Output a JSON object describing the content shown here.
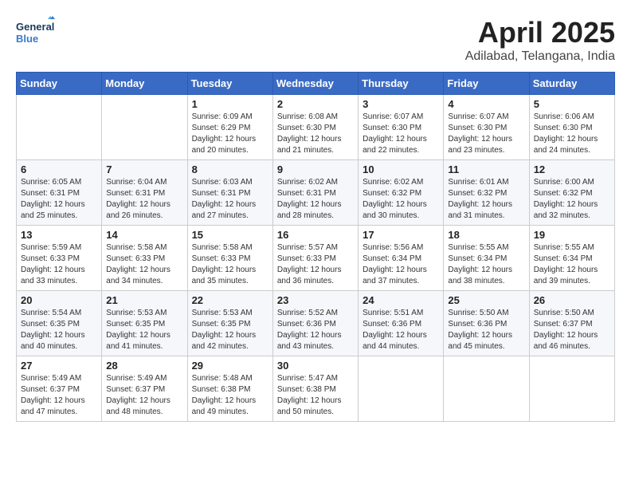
{
  "header": {
    "logo_line1": "General",
    "logo_line2": "Blue",
    "month_year": "April 2025",
    "location": "Adilabad, Telangana, India"
  },
  "weekdays": [
    "Sunday",
    "Monday",
    "Tuesday",
    "Wednesday",
    "Thursday",
    "Friday",
    "Saturday"
  ],
  "weeks": [
    [
      {
        "day": "",
        "sunrise": "",
        "sunset": "",
        "daylight": ""
      },
      {
        "day": "",
        "sunrise": "",
        "sunset": "",
        "daylight": ""
      },
      {
        "day": "1",
        "sunrise": "Sunrise: 6:09 AM",
        "sunset": "Sunset: 6:29 PM",
        "daylight": "Daylight: 12 hours and 20 minutes."
      },
      {
        "day": "2",
        "sunrise": "Sunrise: 6:08 AM",
        "sunset": "Sunset: 6:30 PM",
        "daylight": "Daylight: 12 hours and 21 minutes."
      },
      {
        "day": "3",
        "sunrise": "Sunrise: 6:07 AM",
        "sunset": "Sunset: 6:30 PM",
        "daylight": "Daylight: 12 hours and 22 minutes."
      },
      {
        "day": "4",
        "sunrise": "Sunrise: 6:07 AM",
        "sunset": "Sunset: 6:30 PM",
        "daylight": "Daylight: 12 hours and 23 minutes."
      },
      {
        "day": "5",
        "sunrise": "Sunrise: 6:06 AM",
        "sunset": "Sunset: 6:30 PM",
        "daylight": "Daylight: 12 hours and 24 minutes."
      }
    ],
    [
      {
        "day": "6",
        "sunrise": "Sunrise: 6:05 AM",
        "sunset": "Sunset: 6:31 PM",
        "daylight": "Daylight: 12 hours and 25 minutes."
      },
      {
        "day": "7",
        "sunrise": "Sunrise: 6:04 AM",
        "sunset": "Sunset: 6:31 PM",
        "daylight": "Daylight: 12 hours and 26 minutes."
      },
      {
        "day": "8",
        "sunrise": "Sunrise: 6:03 AM",
        "sunset": "Sunset: 6:31 PM",
        "daylight": "Daylight: 12 hours and 27 minutes."
      },
      {
        "day": "9",
        "sunrise": "Sunrise: 6:02 AM",
        "sunset": "Sunset: 6:31 PM",
        "daylight": "Daylight: 12 hours and 28 minutes."
      },
      {
        "day": "10",
        "sunrise": "Sunrise: 6:02 AM",
        "sunset": "Sunset: 6:32 PM",
        "daylight": "Daylight: 12 hours and 30 minutes."
      },
      {
        "day": "11",
        "sunrise": "Sunrise: 6:01 AM",
        "sunset": "Sunset: 6:32 PM",
        "daylight": "Daylight: 12 hours and 31 minutes."
      },
      {
        "day": "12",
        "sunrise": "Sunrise: 6:00 AM",
        "sunset": "Sunset: 6:32 PM",
        "daylight": "Daylight: 12 hours and 32 minutes."
      }
    ],
    [
      {
        "day": "13",
        "sunrise": "Sunrise: 5:59 AM",
        "sunset": "Sunset: 6:33 PM",
        "daylight": "Daylight: 12 hours and 33 minutes."
      },
      {
        "day": "14",
        "sunrise": "Sunrise: 5:58 AM",
        "sunset": "Sunset: 6:33 PM",
        "daylight": "Daylight: 12 hours and 34 minutes."
      },
      {
        "day": "15",
        "sunrise": "Sunrise: 5:58 AM",
        "sunset": "Sunset: 6:33 PM",
        "daylight": "Daylight: 12 hours and 35 minutes."
      },
      {
        "day": "16",
        "sunrise": "Sunrise: 5:57 AM",
        "sunset": "Sunset: 6:33 PM",
        "daylight": "Daylight: 12 hours and 36 minutes."
      },
      {
        "day": "17",
        "sunrise": "Sunrise: 5:56 AM",
        "sunset": "Sunset: 6:34 PM",
        "daylight": "Daylight: 12 hours and 37 minutes."
      },
      {
        "day": "18",
        "sunrise": "Sunrise: 5:55 AM",
        "sunset": "Sunset: 6:34 PM",
        "daylight": "Daylight: 12 hours and 38 minutes."
      },
      {
        "day": "19",
        "sunrise": "Sunrise: 5:55 AM",
        "sunset": "Sunset: 6:34 PM",
        "daylight": "Daylight: 12 hours and 39 minutes."
      }
    ],
    [
      {
        "day": "20",
        "sunrise": "Sunrise: 5:54 AM",
        "sunset": "Sunset: 6:35 PM",
        "daylight": "Daylight: 12 hours and 40 minutes."
      },
      {
        "day": "21",
        "sunrise": "Sunrise: 5:53 AM",
        "sunset": "Sunset: 6:35 PM",
        "daylight": "Daylight: 12 hours and 41 minutes."
      },
      {
        "day": "22",
        "sunrise": "Sunrise: 5:53 AM",
        "sunset": "Sunset: 6:35 PM",
        "daylight": "Daylight: 12 hours and 42 minutes."
      },
      {
        "day": "23",
        "sunrise": "Sunrise: 5:52 AM",
        "sunset": "Sunset: 6:36 PM",
        "daylight": "Daylight: 12 hours and 43 minutes."
      },
      {
        "day": "24",
        "sunrise": "Sunrise: 5:51 AM",
        "sunset": "Sunset: 6:36 PM",
        "daylight": "Daylight: 12 hours and 44 minutes."
      },
      {
        "day": "25",
        "sunrise": "Sunrise: 5:50 AM",
        "sunset": "Sunset: 6:36 PM",
        "daylight": "Daylight: 12 hours and 45 minutes."
      },
      {
        "day": "26",
        "sunrise": "Sunrise: 5:50 AM",
        "sunset": "Sunset: 6:37 PM",
        "daylight": "Daylight: 12 hours and 46 minutes."
      }
    ],
    [
      {
        "day": "27",
        "sunrise": "Sunrise: 5:49 AM",
        "sunset": "Sunset: 6:37 PM",
        "daylight": "Daylight: 12 hours and 47 minutes."
      },
      {
        "day": "28",
        "sunrise": "Sunrise: 5:49 AM",
        "sunset": "Sunset: 6:37 PM",
        "daylight": "Daylight: 12 hours and 48 minutes."
      },
      {
        "day": "29",
        "sunrise": "Sunrise: 5:48 AM",
        "sunset": "Sunset: 6:38 PM",
        "daylight": "Daylight: 12 hours and 49 minutes."
      },
      {
        "day": "30",
        "sunrise": "Sunrise: 5:47 AM",
        "sunset": "Sunset: 6:38 PM",
        "daylight": "Daylight: 12 hours and 50 minutes."
      },
      {
        "day": "",
        "sunrise": "",
        "sunset": "",
        "daylight": ""
      },
      {
        "day": "",
        "sunrise": "",
        "sunset": "",
        "daylight": ""
      },
      {
        "day": "",
        "sunrise": "",
        "sunset": "",
        "daylight": ""
      }
    ]
  ]
}
